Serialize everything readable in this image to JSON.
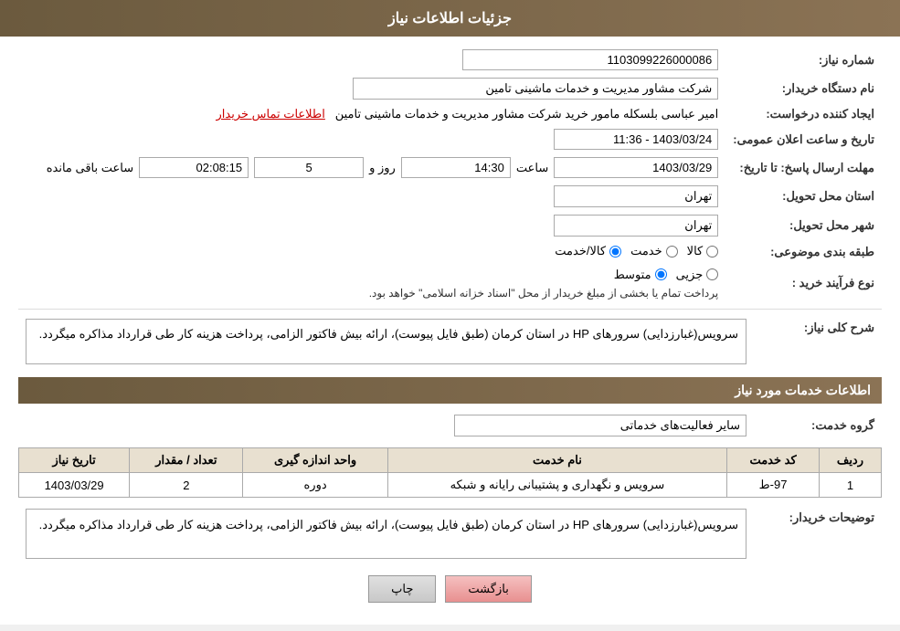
{
  "header": {
    "title": "جزئیات اطلاعات نیاز"
  },
  "fields": {
    "need_number_label": "شماره نیاز:",
    "need_number_value": "1103099226000086",
    "buyer_org_label": "نام دستگاه خریدار:",
    "buyer_org_value": "شرکت مشاور مدیریت و خدمات ماشینی تامین",
    "creator_label": "ایجاد کننده درخواست:",
    "creator_value": "امیر عباسی بلسکله مامور خرید شرکت مشاور مدیریت و خدمات ماشینی تامین",
    "creator_link": "اطلاعات تماس خریدار",
    "announce_label": "تاریخ و ساعت اعلان عمومی:",
    "announce_value": "1403/03/24 - 11:36",
    "response_deadline_label": "مهلت ارسال پاسخ: تا تاریخ:",
    "response_date": "1403/03/29",
    "response_time_label": "ساعت",
    "response_time": "14:30",
    "response_days_label": "روز و",
    "response_days": "5",
    "response_remaining_label": "ساعت باقی مانده",
    "response_remaining": "02:08:15",
    "province_label": "استان محل تحویل:",
    "province_value": "تهران",
    "city_label": "شهر محل تحویل:",
    "city_value": "تهران",
    "category_label": "طبقه بندی موضوعی:",
    "category_kala": "کالا",
    "category_khadamat": "خدمت",
    "category_kala_khadamat": "کالا/خدمت",
    "purchase_type_label": "نوع فرآیند خرید :",
    "purchase_type_jozei": "جزیی",
    "purchase_type_motovaset": "متوسط",
    "purchase_type_note": "پرداخت تمام یا بخشی از مبلغ خریدار از محل \"اسناد خزانه اسلامی\" خواهد بود.",
    "description_label": "شرح کلی نیاز:",
    "description_value": "سرویس(غبارزدایی) سرورهای HP در استان کرمان (طبق فایل پیوست)، ارائه بیش فاکتور الزامی، پرداخت هزینه کار طی قرارداد مذاکره میگردد.",
    "services_section_title": "اطلاعات خدمات مورد نیاز",
    "service_group_label": "گروه خدمت:",
    "service_group_value": "سایر فعالیت‌های خدماتی",
    "table": {
      "col_row": "ردیف",
      "col_code": "کد خدمت",
      "col_name": "نام خدمت",
      "col_unit": "واحد اندازه گیری",
      "col_qty": "تعداد / مقدار",
      "col_date": "تاریخ نیاز",
      "rows": [
        {
          "row": "1",
          "code": "97-ط",
          "name": "سرویس و نگهداری و پشتیبانی رایانه و شبکه",
          "unit": "دوره",
          "qty": "2",
          "date": "1403/03/29"
        }
      ]
    },
    "buyer_notes_label": "توضیحات خریدار:",
    "buyer_notes_value": "سرویس(غبارزدایی) سرورهای HP در استان کرمان (طبق فایل پیوست)، ارائه بیش فاکتور الزامی، پرداخت هزینه کار طی قرارداد مذاکره میگردد."
  },
  "buttons": {
    "print_label": "چاپ",
    "back_label": "بازگشت"
  }
}
